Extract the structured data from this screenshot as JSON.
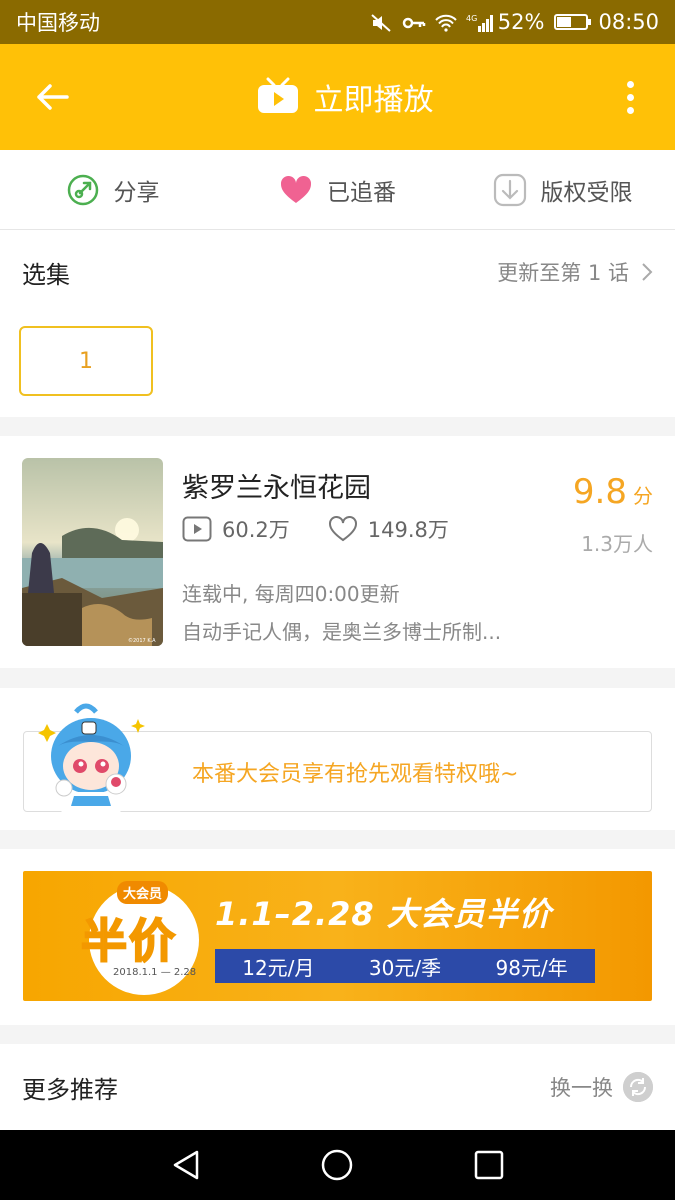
{
  "status": {
    "carrier": "中国移动",
    "battery": "52%",
    "battery_level": 0.52,
    "time": "08:50",
    "net": "4G"
  },
  "header": {
    "title": "立即播放",
    "back_icon": "back-arrow-icon",
    "more_icon": "more-vert-icon"
  },
  "actions": [
    {
      "label": "分享",
      "icon": "share-icon",
      "color": "#4caf50"
    },
    {
      "label": "已追番",
      "icon": "heart-icon",
      "color": "#f06292"
    },
    {
      "label": "版权受限",
      "icon": "download-icon",
      "color": "#bbbbbb"
    }
  ],
  "episodes": {
    "title": "选集",
    "update": "更新至第 1 话",
    "items": [
      "1"
    ]
  },
  "anime": {
    "name": "紫罗兰永恒花园",
    "plays": "60.2万",
    "favorites": "149.8万",
    "schedule": "连载中, 每周四0:00更新",
    "description": "自动手记人偶，是奥兰多博士所制...",
    "score": "9.8",
    "score_unit": "分",
    "voters": "1.3万人",
    "cover_text": "©2017 K.A"
  },
  "promo": {
    "text": "本番大会员享有抢先观看特权哦~"
  },
  "banner": {
    "badge_tag": "大会员",
    "half": "半价",
    "date_small": "2018.1.1 — 2.28",
    "headline": "1.1–2.28  大会员半价",
    "prices": [
      "12元/月",
      "30元/季",
      "98元/年"
    ]
  },
  "more": {
    "title": "更多推荐",
    "swap": "换一换"
  },
  "colors": {
    "accent": "#ffc107",
    "score": "#f5a623",
    "promo": "#f5a623"
  }
}
